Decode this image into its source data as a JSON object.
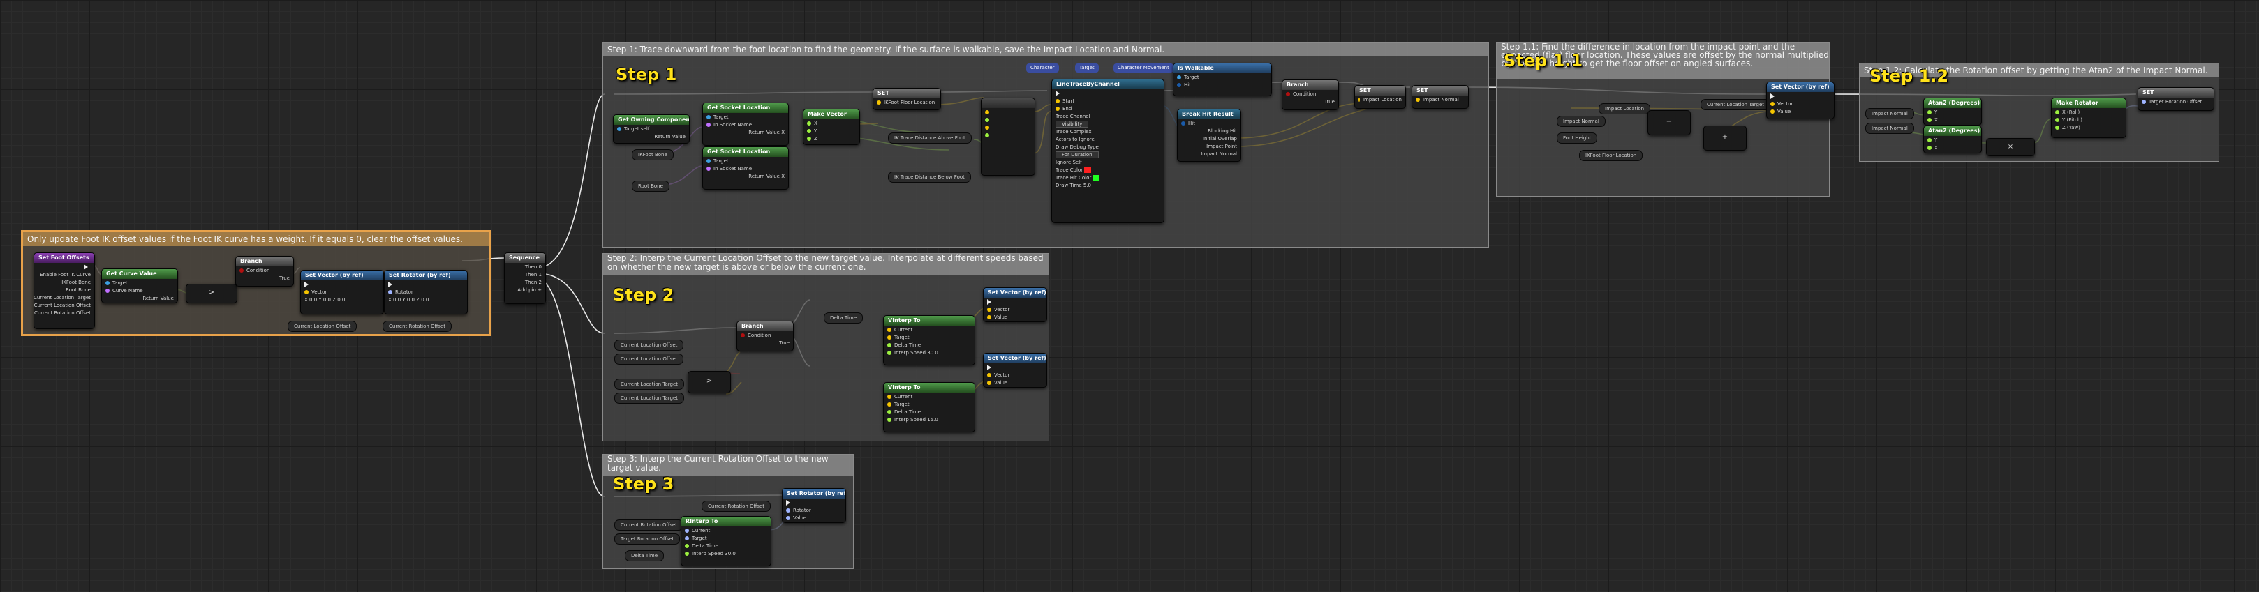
{
  "colors": {
    "exec": "#ffffff",
    "vector": "#f5c400",
    "rotator": "#9fb4ff",
    "float": "#9cf03f",
    "bool": "#b01010",
    "struct": "#1a5aa8",
    "object": "#3da0e0",
    "name": "#c070ff",
    "comment_highlight": "#e8a24a",
    "step_title": "#ffe21a"
  },
  "comments": {
    "c0": {
      "text": "Only update Foot IK offset values if the Foot IK curve has a weight. If it equals 0, clear the offset values."
    },
    "c1": {
      "text": "Step 1: Trace downward from the foot location to find the geometry. If the surface is walkable, save the Impact Location and Normal.",
      "title": "Step 1"
    },
    "c11": {
      "text": "Step 1.1: Find the difference in location from the impact point and the expected (flat) floor location. These values are offset by the normal multiplied by the foot height to get the floor offset on angled surfaces.",
      "title": "Step 1.1"
    },
    "c12": {
      "text": "Step 1.2: Calculate the Rotation offset by getting the Atan2 of the Impact Normal.",
      "title": "Step 1.2"
    },
    "c2": {
      "text": "Step 2: Interp the Current Location Offset to the new target value. Interpolate at different speeds based on whether the new target is above or below the current one.",
      "title": "Step 2"
    },
    "c3": {
      "text": "Step 3: Interp the Current Rotation Offset to the new target value.",
      "title": "Step 3"
    }
  },
  "nodes": {
    "set_foot_offsets": {
      "title": "Set Foot Offsets",
      "pins": [
        "Enable Foot IK Curve",
        "IKFoot Bone",
        "Root Bone",
        "Current Location Target",
        "Current Location Offset",
        "Current Rotation Offset"
      ]
    },
    "get_curve_value": {
      "title": "Get Curve Value",
      "pins": [
        "Target",
        "Curve Name",
        "Return Value"
      ]
    },
    "branch_a": {
      "title": "Branch",
      "pins": [
        "Condition",
        "True",
        "False"
      ]
    },
    "greater": {
      "label": ">"
    },
    "set_vector_a": {
      "title": "Set Vector (by ref)",
      "pins": [
        "Vector",
        "X 0.0  Y 0.0  Z 0.0"
      ]
    },
    "set_rotator_a": {
      "title": "Set Rotator (by ref)",
      "pins": [
        "Rotator",
        "X 0.0  Y 0.0  Z 0.0"
      ]
    },
    "reroute_clo": "Current Location Offset",
    "reroute_cro": "Current Rotation Offset",
    "sequence": {
      "title": "Sequence",
      "pins": [
        "Then 0",
        "Then 1",
        "Then 2",
        "Add pin +"
      ]
    },
    "get_owning_component": {
      "title": "Get Owning Component",
      "pins": [
        "Target",
        "self",
        "Return Value"
      ]
    },
    "get_socket_loc_1": {
      "title": "Get Socket Location",
      "pins": [
        "Target",
        "In Socket Name",
        "Return Value X",
        "Return Value Y",
        "Return Value Z"
      ]
    },
    "get_socket_loc_2": {
      "title": "Get Socket Location",
      "pins": [
        "Target",
        "In Socket Name",
        "Return Value X",
        "Return Value Y",
        "Return Value Z"
      ]
    },
    "make_vector": {
      "title": "Make Vector",
      "pins": [
        "X",
        "Y",
        "Z",
        "Return Value"
      ]
    },
    "set_step1": {
      "title": "SET",
      "pins": [
        "IKFoot Floor Location"
      ]
    },
    "reroute_ikfoot": "IKFoot Bone",
    "reroute_root": "Root Bone",
    "reroute_zoff_1": "IK Trace Distance Above Foot",
    "reroute_zoff_2": "IK Trace Distance Below Foot",
    "line_trace": {
      "title": "LineTraceByChannel",
      "pins": [
        "Start",
        "End",
        "Trace Channel",
        "Visibility",
        "Trace Complex",
        "Actors to Ignore",
        "Draw Debug Type",
        "For Duration",
        "Ignore Self",
        "Trace Color",
        "Trace Hit Color",
        "Draw Time 5.0",
        "Out Hit",
        "Return Value"
      ]
    },
    "character": {
      "title": "Character"
    },
    "target_pill": {
      "title": "Target"
    },
    "char_movement": {
      "title": "Character Movement"
    },
    "is_walkable": {
      "title": "Is Walkable",
      "pins": [
        "Target",
        "Hit",
        "Return Value"
      ]
    },
    "break_hit": {
      "title": "Break Hit Result",
      "pins": [
        "Hit",
        "Blocking Hit",
        "Initial Overlap",
        "Impact Point",
        "Impact Normal"
      ]
    },
    "branch_b": {
      "title": "Branch",
      "pins": [
        "Condition",
        "True",
        "False"
      ]
    },
    "set_impact_loc": {
      "title": "SET",
      "pins": [
        "Impact Location"
      ]
    },
    "set_impact_norm": {
      "title": "SET",
      "pins": [
        "Impact Normal"
      ]
    },
    "step11_impact_loc": "Impact Location",
    "step11_impact_normal": "Impact Normal",
    "step11_foot_height": "Foot Height",
    "step11_floor_loc": "IKFoot Floor Location",
    "step11_loc_target": "Current Location Target",
    "set_vector_b": {
      "title": "Set Vector (by ref)",
      "pins": [
        "Vector",
        "Value"
      ]
    },
    "step12_impact_normal_1": "Impact Normal",
    "step12_impact_normal_2": "Impact Normal",
    "atan_1": {
      "title": "Atan2 (Degrees)",
      "pins": [
        "Y",
        "X",
        "Return Value"
      ]
    },
    "atan_2": {
      "title": "Atan2 (Degrees)",
      "pins": [
        "Y",
        "X",
        "Return Value"
      ]
    },
    "make_rotator": {
      "title": "Make Rotator",
      "pins": [
        "X (Roll)",
        "Y (Pitch)",
        "Z (Yaw)",
        "Return Value"
      ]
    },
    "set_rot_target": {
      "title": "SET",
      "pins": [
        "Target Rotation Offset"
      ]
    },
    "step2_clo_1": "Current Location Offset",
    "step2_clo_2": "Current Location Offset",
    "step2_clt_1": "Current Location Target",
    "step2_clt_2": "Current Location Target",
    "branch_c": {
      "title": "Branch",
      "pins": [
        "Condition",
        "True",
        "False"
      ]
    },
    "vinterp_1": {
      "title": "VInterp To",
      "pins": [
        "Current",
        "Target",
        "Delta Time",
        "Interp Speed 30.0",
        "Return Value"
      ]
    },
    "vinterp_2": {
      "title": "VInterp To",
      "pins": [
        "Current",
        "Target",
        "Delta Time",
        "Interp Speed 15.0",
        "Return Value"
      ]
    },
    "set_vector_c": {
      "title": "Set Vector (by ref)",
      "pins": [
        "Vector",
        "Value"
      ]
    },
    "set_vector_d": {
      "title": "Set Vector (by ref)",
      "pins": [
        "Vector",
        "Value"
      ]
    },
    "delta_time": "Delta Time",
    "step3_cro": "Current Rotation Offset",
    "step3_tro": "Target Rotation Offset",
    "rinterp": {
      "title": "RInterp To",
      "pins": [
        "Current",
        "Target",
        "Delta Time",
        "Interp Speed 30.0",
        "Return Value"
      ]
    },
    "set_rotator_b": {
      "title": "Set Rotator (by ref)",
      "pins": [
        "Rotator",
        "Value"
      ]
    }
  }
}
